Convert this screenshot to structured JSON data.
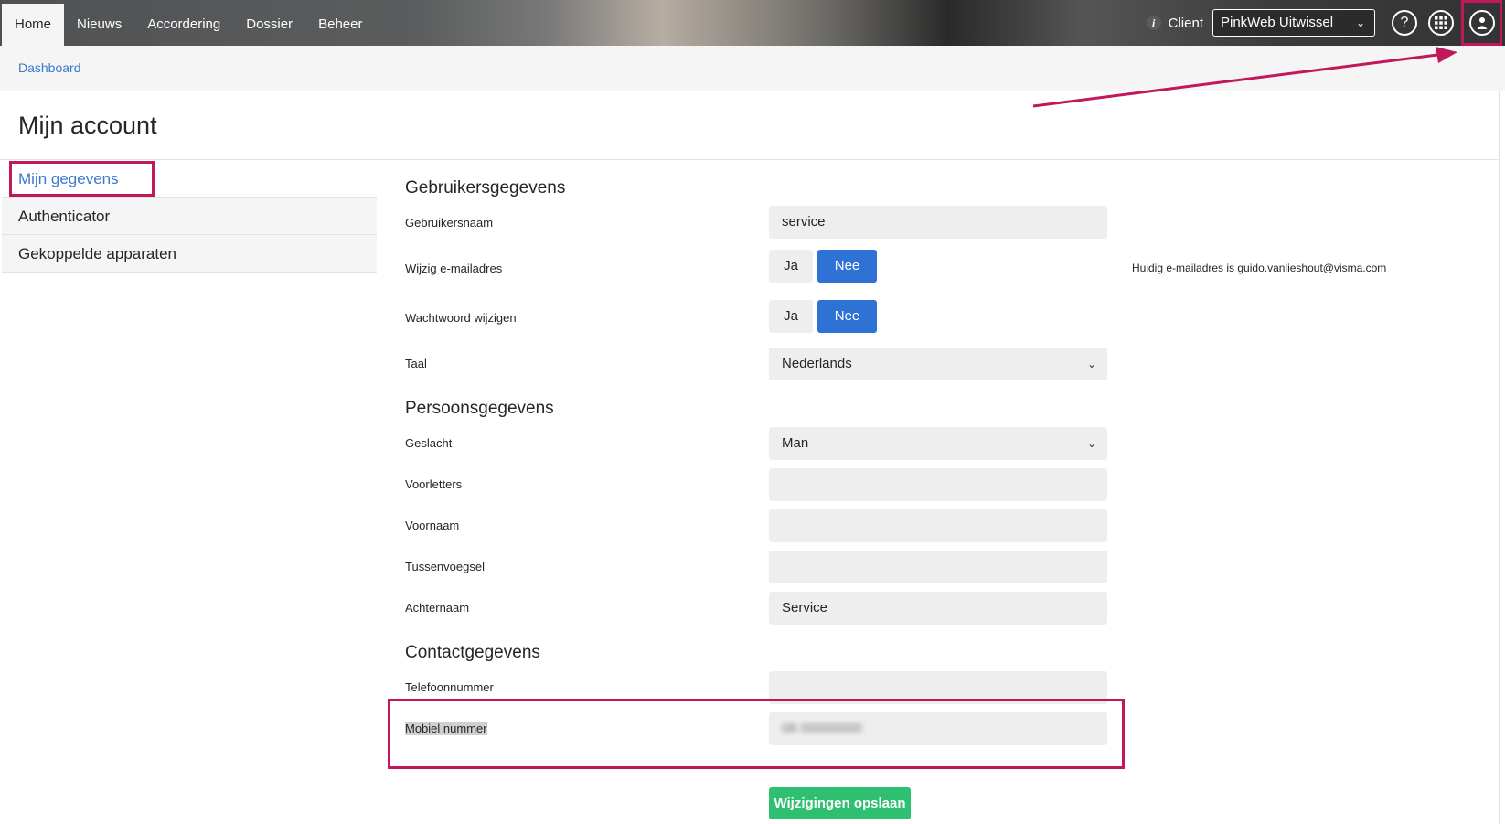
{
  "nav": {
    "items": [
      "Home",
      "Nieuws",
      "Accordering",
      "Dossier",
      "Beheer"
    ],
    "active_index": 0
  },
  "header": {
    "client_label": "Client",
    "client_value": "PinkWeb Uitwissel",
    "icons": [
      "info-icon",
      "help-icon",
      "apps-grid-icon",
      "user-account-icon"
    ]
  },
  "breadcrumb": {
    "label": "Dashboard"
  },
  "page": {
    "title": "Mijn account"
  },
  "sidebar": {
    "items": [
      {
        "label": "Mijn gegevens",
        "active": true
      },
      {
        "label": "Authenticator",
        "active": false
      },
      {
        "label": "Gekoppelde apparaten",
        "active": false
      }
    ]
  },
  "form": {
    "user_section": "Gebruikersgegevens",
    "username_label": "Gebruikersnaam",
    "username_value": "service",
    "change_email_label": "Wijzig e-mailadres",
    "change_email_options": [
      "Ja",
      "Nee"
    ],
    "change_email_selected": "Nee",
    "current_email_note": "Huidig e-mailadres is guido.vanlieshout@visma.com",
    "change_password_label": "Wachtwoord wijzigen",
    "change_password_options": [
      "Ja",
      "Nee"
    ],
    "change_password_selected": "Nee",
    "language_label": "Taal",
    "language_value": "Nederlands",
    "person_section": "Persoonsgegevens",
    "gender_label": "Geslacht",
    "gender_value": "Man",
    "initials_label": "Voorletters",
    "initials_value": "",
    "firstname_label": "Voornaam",
    "firstname_value": "",
    "infix_label": "Tussenvoegsel",
    "infix_value": "",
    "lastname_label": "Achternaam",
    "lastname_value": "Service",
    "contact_section": "Contactgegevens",
    "phone_label": "Telefoonnummer",
    "phone_value": "",
    "mobile_label": "Mobiel nummer",
    "mobile_value": "06 00000000",
    "save_label": "Wijzigingen opslaan"
  },
  "colors": {
    "accent_blue": "#2e72d6",
    "link_blue": "#3b78d1",
    "save_green": "#2fbf71",
    "annotation": "#c0185b",
    "field_bg": "#eeeeee"
  }
}
